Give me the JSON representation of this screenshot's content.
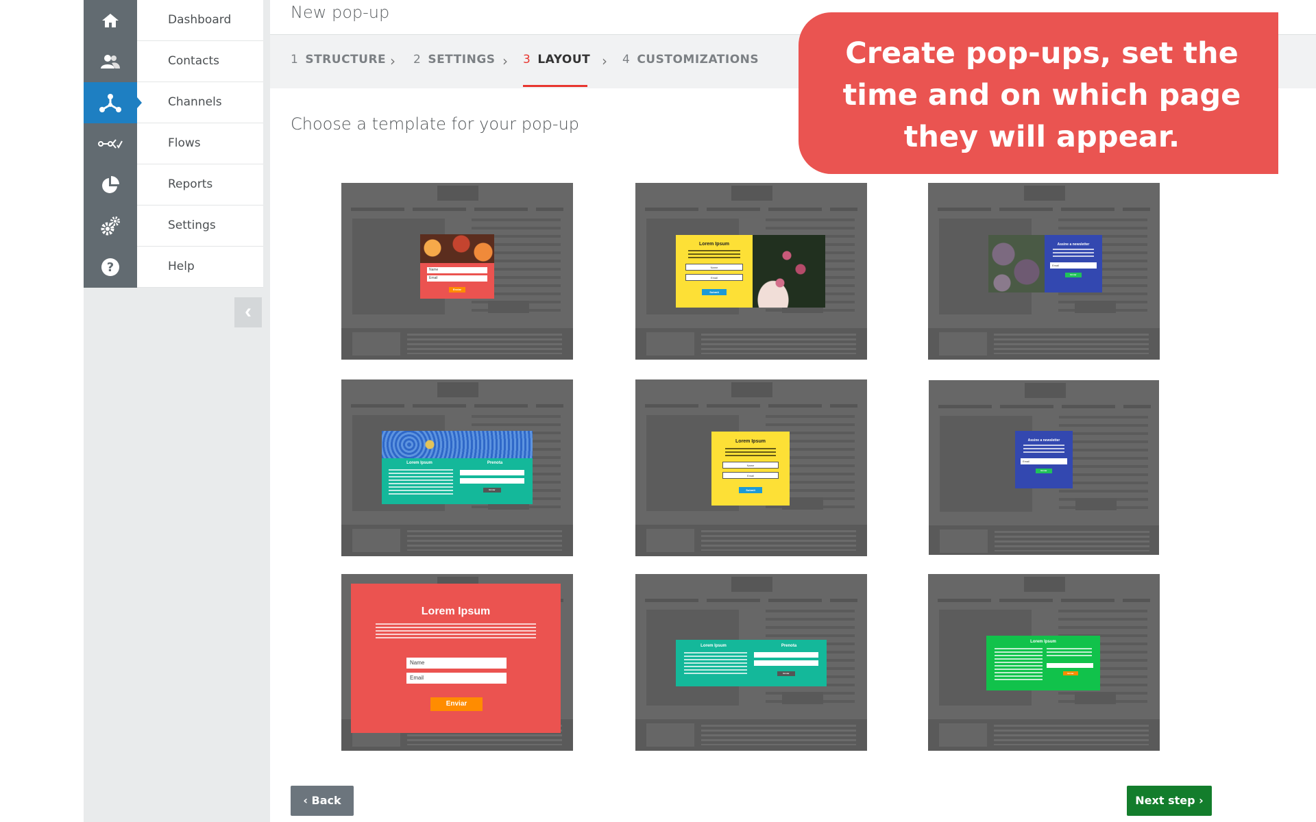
{
  "sidebar": {
    "items": [
      {
        "label": "Dashboard",
        "icon": "home-icon",
        "active": false
      },
      {
        "label": "Contacts",
        "icon": "contacts-icon",
        "active": false
      },
      {
        "label": "Channels",
        "icon": "channels-icon",
        "active": true
      },
      {
        "label": "Flows",
        "icon": "flows-icon",
        "active": false
      },
      {
        "label": "Reports",
        "icon": "reports-icon",
        "active": false
      },
      {
        "label": "Settings",
        "icon": "settings-icon",
        "active": false
      },
      {
        "label": "Help",
        "icon": "help-icon",
        "active": false
      }
    ],
    "collapse_glyph": "‹"
  },
  "header": {
    "title": "New pop-up"
  },
  "steps": [
    {
      "num": "1",
      "label": "STRUCTURE",
      "active": false
    },
    {
      "num": "2",
      "label": "SETTINGS",
      "active": false
    },
    {
      "num": "3",
      "label": "LAYOUT",
      "active": true
    },
    {
      "num": "4",
      "label": "CUSTOMIZATIONS",
      "active": false
    }
  ],
  "step_separator": "›",
  "main": {
    "subtitle": "Choose a template for your pop-up"
  },
  "callout": {
    "text": "Create pop-ups, set the time and on which page they will appear."
  },
  "templates": {
    "lorem": "Lorem Ipsum",
    "prenotate": "Prenota",
    "newsletter": "Assine a newsletter",
    "name_field": "Name",
    "email_field": "Email",
    "submit": "Enviar",
    "submit_alt": "Submit"
  },
  "footer": {
    "back_label": "Back",
    "next_label": "Next step"
  },
  "colors": {
    "accent_red": "#e8352e",
    "callout": "#ea5451",
    "active_nav": "#1e7fc2",
    "next_button": "#137d2c",
    "popup_red": "#eb5350",
    "popup_yellow": "#fde036",
    "popup_blue": "#3348b0",
    "popup_teal": "#14b89a",
    "popup_green": "#11c24b"
  }
}
